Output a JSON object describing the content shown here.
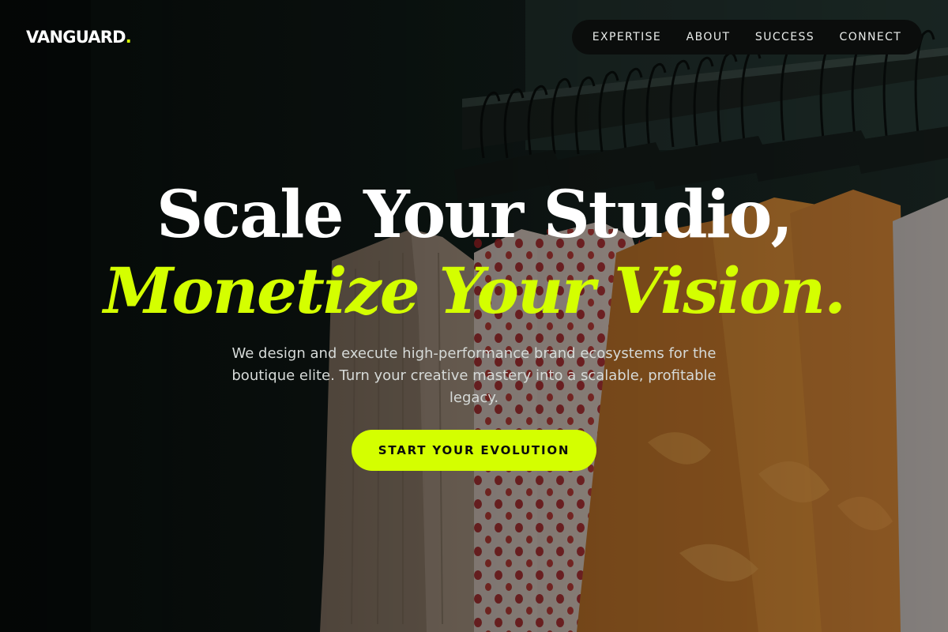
{
  "brand": {
    "name": "VANGUARD",
    "dot": ".",
    "accent_color": "#d4ff00"
  },
  "nav": {
    "items": [
      {
        "label": "EXPERTISE"
      },
      {
        "label": "ABOUT"
      },
      {
        "label": "SUCCESS"
      },
      {
        "label": "CONNECT"
      }
    ]
  },
  "hero": {
    "background_image": "clothing-rack-with-hangers",
    "headline_line1": "Scale Your Studio,",
    "headline_line2": "Monetize Your Vision.",
    "description": "We design and execute high-performance brand ecosystems for the boutique elite. Turn your creative mastery into a scalable, profitable legacy.",
    "cta_label": "START YOUR EVOLUTION"
  }
}
